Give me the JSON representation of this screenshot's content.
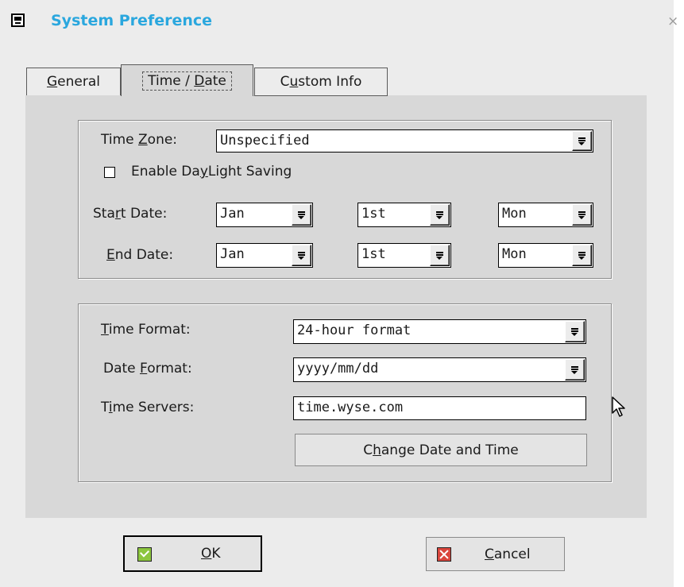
{
  "window": {
    "title": "System Preference",
    "close_glyph": "×",
    "app_icon": "system-preference-icon"
  },
  "tabs": [
    {
      "label": "General",
      "mnemonic": "G",
      "rest": "eneral",
      "selected": false
    },
    {
      "label": "Time / Date",
      "pre": "Time / ",
      "mnemonic": "D",
      "rest": "ate",
      "selected": true
    },
    {
      "label": "Custom Info",
      "pre": "C",
      "mnemonic": "u",
      "rest": "stom Info",
      "selected": false
    }
  ],
  "time_zone": {
    "label_pre": "Time ",
    "label_mnemonic": "Z",
    "label_rest": "one:",
    "value": "Unspecified"
  },
  "daylight": {
    "label_pre": "Enable Da",
    "label_mnemonic": "y",
    "label_rest": "Light Saving",
    "checked": false
  },
  "start_date": {
    "label_pre": "Sta",
    "label_mnemonic": "r",
    "label_rest": "t Date:",
    "month": "Jan",
    "week": "1st",
    "day": "Mon"
  },
  "end_date": {
    "label_pre": "",
    "label_mnemonic": "E",
    "label_rest": "nd Date:",
    "month": "Jan",
    "week": "1st",
    "day": "Mon"
  },
  "time_format": {
    "label_pre": "",
    "label_mnemonic": "T",
    "label_rest": "ime Format:",
    "value": "24-hour format"
  },
  "date_format": {
    "label_pre": "Date ",
    "label_mnemonic": "F",
    "label_rest": "ormat:",
    "value": "yyyy/mm/dd"
  },
  "time_servers": {
    "label_pre": "T",
    "label_mnemonic": "i",
    "label_rest": "me Servers:",
    "value": "time.wyse.com"
  },
  "change_button": {
    "pre": "C",
    "mnemonic": "h",
    "rest": "ange Date and Time"
  },
  "ok_button": {
    "mnemonic": "O",
    "rest": "K",
    "icon": "check-icon"
  },
  "cancel_button": {
    "mnemonic": "C",
    "rest": "ancel",
    "icon": "x-icon"
  },
  "colors": {
    "title": "#2aa7de",
    "panel": "#d8d8d8",
    "window": "#ececec",
    "ok_icon": "#8cc63f",
    "cancel_icon": "#d9453c"
  }
}
